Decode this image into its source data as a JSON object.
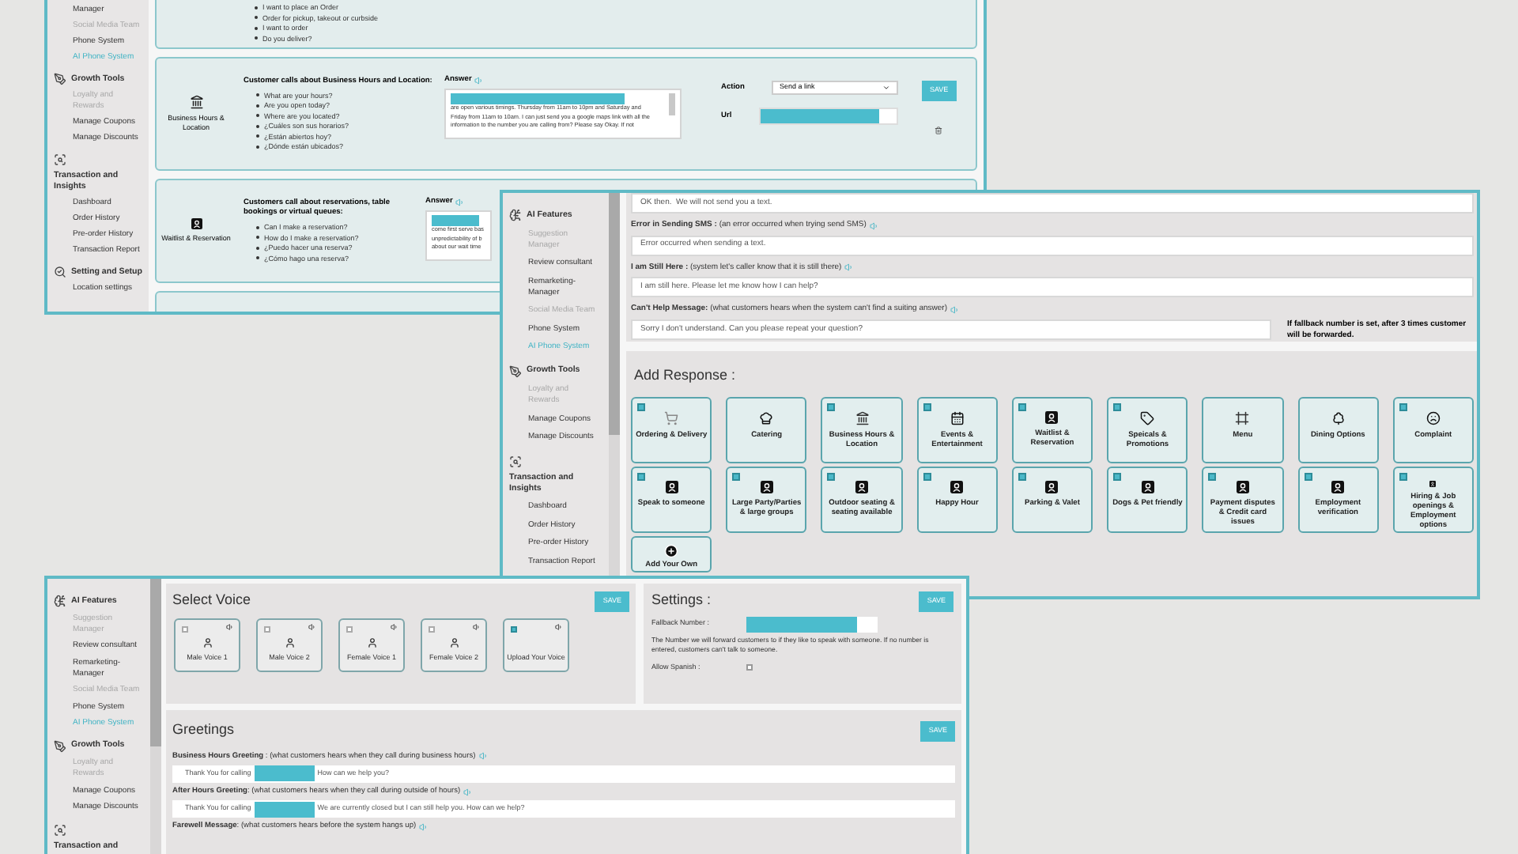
{
  "intent_window": {
    "sidebar": [
      {
        "label": "Manager",
        "kind": "link",
        "selected": false,
        "disabled": false
      },
      {
        "label": "Social Media Team",
        "kind": "link",
        "selected": false,
        "disabled": true
      },
      {
        "label": "Phone System",
        "kind": "link",
        "selected": false,
        "disabled": false
      },
      {
        "label": "AI Phone System",
        "kind": "link",
        "selected": true,
        "disabled": false
      },
      {
        "label": "Growth Tools",
        "kind": "tools",
        "selected": false,
        "disabled": false
      },
      {
        "label": "Loyalty and Rewards",
        "kind": "link",
        "selected": false,
        "disabled": true
      },
      {
        "label": "Manage Coupons",
        "kind": "link",
        "selected": false,
        "disabled": false
      },
      {
        "label": "Manage Discounts",
        "kind": "link",
        "selected": false,
        "disabled": false
      },
      {
        "label": "Transaction and Insights",
        "kind": "insights",
        "selected": false,
        "disabled": false
      },
      {
        "label": "Dashboard",
        "kind": "link",
        "selected": false,
        "disabled": false
      },
      {
        "label": "Order History",
        "kind": "link",
        "selected": false,
        "disabled": false
      },
      {
        "label": "Pre-order History",
        "kind": "link",
        "selected": false,
        "disabled": false
      },
      {
        "label": "Transaction Report",
        "kind": "link",
        "selected": false,
        "disabled": false
      },
      {
        "label": "Setting and Setup",
        "kind": "setup",
        "selected": false,
        "disabled": false
      },
      {
        "label": "Location settings",
        "kind": "link",
        "selected": false,
        "disabled": false
      }
    ],
    "intents": [
      {
        "kind": "partial",
        "questions": [
          "I want to place an Order",
          "Order for pickup, takeout or curbside",
          "I want to order",
          "Do you deliver?"
        ]
      },
      {
        "kind": "full",
        "label": "Business Hours & Location",
        "title": "Customer calls about Business Hours and Location:",
        "questions": [
          "What are your hours?",
          "Are you open today?",
          "Where are you located?",
          "¿Cuáles son sus horarios?",
          "¿Están abiertos hoy?",
          "¿Dónde están ubicados?"
        ],
        "answer_label": "Answer",
        "answer_lines": [
          "are open various timings. Thursday from 11am to 10pm and Saturday and",
          "Friday from 11am to 10am. I can just send you a google maps link with all the",
          "information to the number you are calling from? Please say Okay. If not"
        ],
        "action_label": "Action",
        "action_value": "Send a link",
        "url_label": "Url",
        "save": "SAVE"
      },
      {
        "kind": "covered",
        "label": "Waitlist & Reservation",
        "title": "Customers call about reservations, table bookings or virtual queues:",
        "questions": [
          "Can I make a reservation?",
          "How do I make a reservation?",
          "¿Puedo hacer una reserva?",
          "¿Cómo hago una reserva?"
        ],
        "answer_label": "Answer",
        "answer_lines": [
          "come first serve bas",
          "unpredictability of b",
          "about our wait time"
        ]
      },
      {
        "kind": "empty"
      }
    ]
  },
  "messages_window": {
    "sidebar": [
      {
        "label": "AI Features",
        "kind": "ai",
        "selected": false,
        "disabled": false
      },
      {
        "label": "Suggestion Manager",
        "kind": "link",
        "selected": false,
        "disabled": true
      },
      {
        "label": "Review consultant",
        "kind": "link",
        "selected": false,
        "disabled": false
      },
      {
        "label": "Remarketing-Manager",
        "kind": "link",
        "selected": false,
        "disabled": false
      },
      {
        "label": "Social Media Team",
        "kind": "link",
        "selected": false,
        "disabled": true
      },
      {
        "label": "Phone System",
        "kind": "link",
        "selected": false,
        "disabled": false
      },
      {
        "label": "AI Phone System",
        "kind": "link",
        "selected": true,
        "disabled": false
      },
      {
        "label": "Growth Tools",
        "kind": "tools",
        "selected": false,
        "disabled": false
      },
      {
        "label": "Loyalty and Rewards",
        "kind": "link",
        "selected": false,
        "disabled": true
      },
      {
        "label": "Manage Coupons",
        "kind": "link",
        "selected": false,
        "disabled": false
      },
      {
        "label": "Manage Discounts",
        "kind": "link",
        "selected": false,
        "disabled": false
      },
      {
        "label": "Transaction and Insights",
        "kind": "insights",
        "selected": false,
        "disabled": false
      },
      {
        "label": "Dashboard",
        "kind": "link",
        "selected": false,
        "disabled": false
      },
      {
        "label": "Order History",
        "kind": "link",
        "selected": false,
        "disabled": false
      },
      {
        "label": "Pre-order History",
        "kind": "link",
        "selected": false,
        "disabled": false
      },
      {
        "label": "Transaction Report",
        "kind": "link",
        "selected": false,
        "disabled": false
      }
    ],
    "messages": [
      {
        "value": "OK then.  We will not send you a text."
      },
      {
        "label": "**Error in Sending SMS :** (an error occurred when trying send SMS)",
        "value": "Error occurred when sending a text."
      },
      {
        "label": "**I am Still Here :** (system let's caller know that it is still there)",
        "value": "I am still here. Please let me know how I can help?"
      },
      {
        "label": "**Can't Help Message:** (what customers hears when the system can't find a suiting answer)",
        "value": "Sorry I don't understand. Can you please repeat your question?",
        "note": "If fallback number is set, after 3 times customer will be forwarded."
      }
    ],
    "add_response": {
      "title": "Add Response :",
      "tiles": [
        {
          "kind": "option",
          "label": "Ordering & Delivery",
          "checked": true
        },
        {
          "kind": "option",
          "label": "Catering",
          "checked": false
        },
        {
          "kind": "option",
          "label": "Business Hours & Location",
          "checked": true
        },
        {
          "kind": "option",
          "label": "Events & Entertainment",
          "checked": true
        },
        {
          "kind": "option",
          "label": "Waitlist & Reservation",
          "checked": true
        },
        {
          "kind": "option",
          "label": "Speicals & Promotions",
          "checked": true
        },
        {
          "kind": "option",
          "label": "Menu",
          "checked": false
        },
        {
          "kind": "option",
          "label": "Dining Options",
          "checked": false
        },
        {
          "kind": "option",
          "label": "Complaint",
          "checked": true
        },
        {
          "kind": "option",
          "label": "Speak to someone",
          "checked": true
        },
        {
          "kind": "option",
          "label": "Large Party/Parties & large groups",
          "checked": true
        },
        {
          "kind": "option",
          "label": "Outdoor seating & seating available",
          "checked": true
        },
        {
          "kind": "option",
          "label": "Happy Hour",
          "checked": true
        },
        {
          "kind": "option",
          "label": "Parking & Valet",
          "checked": true
        },
        {
          "kind": "option",
          "label": "Dogs & Pet friendly",
          "checked": true
        },
        {
          "kind": "option",
          "label": "Payment disputes & Credit card issues",
          "checked": true
        },
        {
          "kind": "option",
          "label": "Employment verification",
          "checked": true
        },
        {
          "kind": "option",
          "label": "Hiring & Job openings & Employment options",
          "checked": true
        },
        {
          "kind": "add",
          "label": "Add Your Own",
          "checked": false
        }
      ]
    }
  },
  "voice_window": {
    "sidebar": [
      {
        "label": "AI Features",
        "kind": "ai",
        "selected": false,
        "disabled": false
      },
      {
        "label": "Suggestion Manager",
        "kind": "link",
        "selected": false,
        "disabled": true
      },
      {
        "label": "Review consultant",
        "kind": "link",
        "selected": false,
        "disabled": false
      },
      {
        "label": "Remarketing-Manager",
        "kind": "link",
        "selected": false,
        "disabled": false
      },
      {
        "label": "Social Media Team",
        "kind": "link",
        "selected": false,
        "disabled": true
      },
      {
        "label": "Phone System",
        "kind": "link",
        "selected": false,
        "disabled": false
      },
      {
        "label": "AI Phone System",
        "kind": "link",
        "selected": true,
        "disabled": false
      },
      {
        "label": "Growth Tools",
        "kind": "tools",
        "selected": false,
        "disabled": false
      },
      {
        "label": "Loyalty and Rewards",
        "kind": "link",
        "selected": false,
        "disabled": true
      },
      {
        "label": "Manage Coupons",
        "kind": "link",
        "selected": false,
        "disabled": false
      },
      {
        "label": "Manage Discounts",
        "kind": "link",
        "selected": false,
        "disabled": false
      },
      {
        "label": "Transaction and",
        "kind": "insights",
        "selected": false,
        "disabled": false
      }
    ],
    "voices": {
      "title": "Select Voice",
      "save": "SAVE",
      "items": [
        {
          "kind": "voice",
          "label": "Male Voice 1",
          "checked": false
        },
        {
          "kind": "voice",
          "label": "Male Voice 2",
          "checked": false
        },
        {
          "kind": "voice",
          "label": "Female Voice 1",
          "checked": false
        },
        {
          "kind": "voice",
          "label": "Female Voice 2",
          "checked": false
        },
        {
          "kind": "upload",
          "label": "Upload Your Voice",
          "checked": true
        }
      ]
    },
    "settings": {
      "title": "Settings :",
      "save": "SAVE",
      "fallback_label": "Fallback Number :",
      "description": "The Number we will forward customers to if they like to speak with someone. If no number is entered, customers can't talk to someone.",
      "spanish_label": "Allow Spanish :",
      "allow_spanish": false
    },
    "greetings": {
      "title": "Greetings",
      "save": "SAVE",
      "items": [
        {
          "label": "**Business Hours Greeting** : (what customers hears when they call during business hours)",
          "before": "Thank You for calling",
          "after": "How can we help you?"
        },
        {
          "label": "**After Hours Greeting**: (what customers hears when they call during outside of hours)",
          "before": "Thank You for calling",
          "after": "We are currently closed but I can still help you. How can we help?"
        },
        {
          "label": "**Farewell Message**: (what customers hears before the system hangs up)"
        }
      ]
    }
  }
}
